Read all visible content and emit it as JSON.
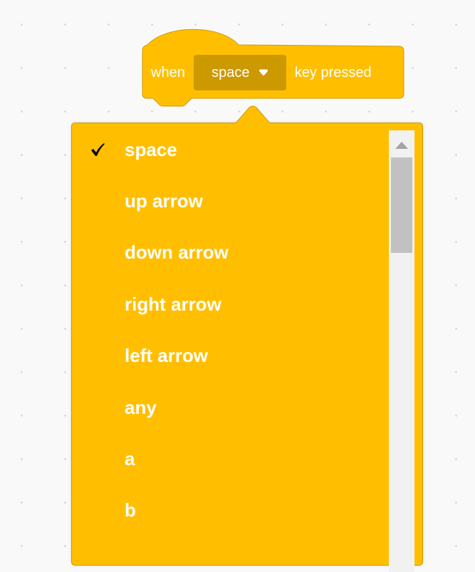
{
  "hat_block": {
    "prefix": "when",
    "selected_key": "space",
    "suffix": "key pressed",
    "caret_icon": "caret-down-icon"
  },
  "dropdown": {
    "selected_index": 0,
    "check_icon": "checkmark-icon",
    "items": [
      {
        "label": "space"
      },
      {
        "label": "up arrow"
      },
      {
        "label": "down arrow"
      },
      {
        "label": "right arrow"
      },
      {
        "label": "left arrow"
      },
      {
        "label": "any"
      },
      {
        "label": "a"
      },
      {
        "label": "b"
      }
    ]
  },
  "scrollbar": {
    "up_arrow_icon": "scroll-up-arrow-icon"
  },
  "colors": {
    "events_yellow": "#ffbf00",
    "events_dark": "#cc9900",
    "canvas_bg": "#f9f9f9",
    "text": "#ffffff"
  }
}
